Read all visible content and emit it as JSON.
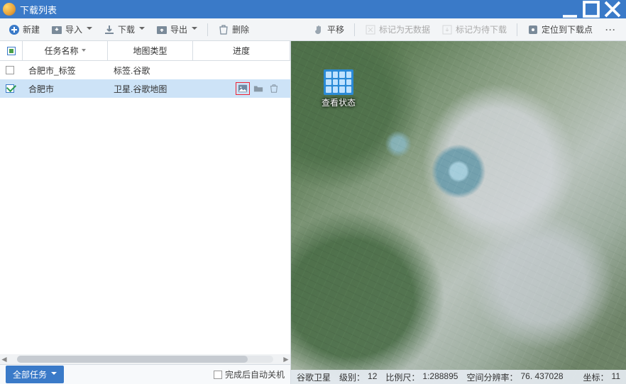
{
  "window": {
    "title": "下载列表"
  },
  "toolbar_left": {
    "new_label": "新建",
    "import_label": "导入",
    "download_label": "下载",
    "export_label": "导出",
    "delete_label": "删除"
  },
  "toolbar_right": {
    "pan_label": "平移",
    "mark_nodata_label": "标记为无数据",
    "mark_pending_label": "标记为待下载",
    "locate_label": "定位到下载点",
    "more_label": "···"
  },
  "task_table": {
    "header": {
      "name": "任务名称",
      "type": "地图类型",
      "progress": "进度"
    },
    "rows": [
      {
        "checked": false,
        "name": "合肥市_标签",
        "type": "标签.谷歌",
        "selected": false
      },
      {
        "checked": true,
        "name": "合肥市",
        "type": "卫星.谷歌地图",
        "selected": true
      }
    ]
  },
  "footer": {
    "all_tasks_label": "全部任务",
    "auto_shutdown_label": "完成后自动关机"
  },
  "map": {
    "overlay_label": "查看状态",
    "status": {
      "source_label": "谷歌卫星",
      "level_label": "级别：",
      "level_value": "12",
      "scale_label": "比例尺：",
      "scale_value": "1:288895",
      "resolution_label": "空间分辨率：",
      "resolution_value": "76. 437028",
      "coord_label": "坐标：",
      "coord_value": "11"
    }
  }
}
